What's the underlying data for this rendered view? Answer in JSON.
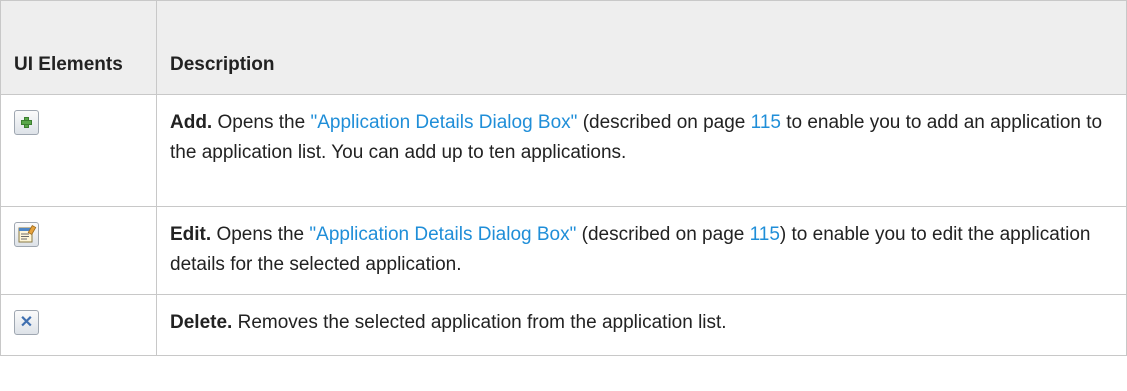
{
  "table": {
    "headers": {
      "ui_elements": "UI Elements",
      "description": "Description"
    },
    "rows": [
      {
        "icon": "add-plus-icon",
        "title": "Add.",
        "pre_link": " Opens the ",
        "link_text": "\"Application Details Dialog Box\"",
        "mid_text": " (described on page ",
        "page": "115",
        "post_text": " to enable you to add an application to the application list. You can add up to ten applications."
      },
      {
        "icon": "edit-properties-icon",
        "title": "Edit.",
        "pre_link": " Opens the ",
        "link_text": "\"Application Details Dialog Box\"",
        "mid_text": " (described on page ",
        "page": "115",
        "post_text": ") to enable you to edit the application details for the selected application."
      },
      {
        "icon": "delete-x-icon",
        "title": "Delete.",
        "description": " Removes the selected application from the application list."
      }
    ]
  },
  "colors": {
    "link": "#1f8ed8",
    "header_bg": "#eeeeee",
    "border": "#c8c8c8"
  }
}
